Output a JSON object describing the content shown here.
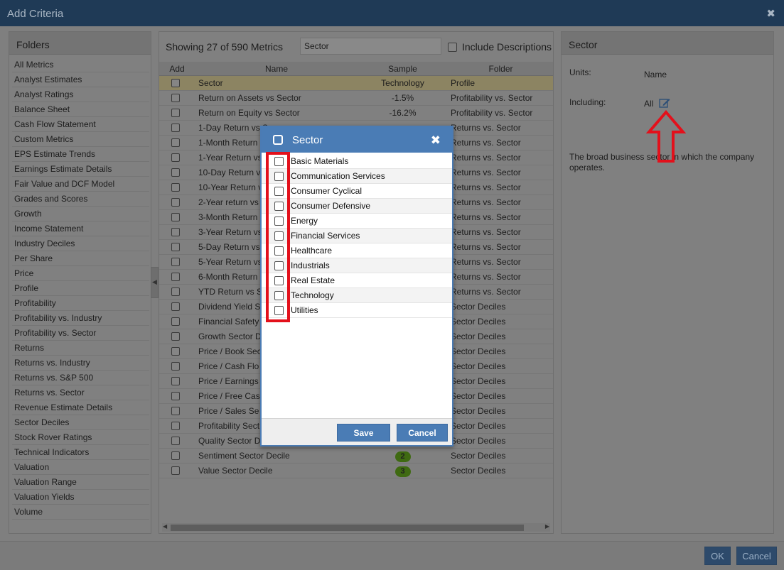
{
  "window": {
    "title": "Add Criteria",
    "close_glyph": "✖"
  },
  "folders": {
    "header": "Folders",
    "items": [
      "All Metrics",
      "Analyst Estimates",
      "Analyst Ratings",
      "Balance Sheet",
      "Cash Flow Statement",
      "Custom Metrics",
      "EPS Estimate Trends",
      "Earnings Estimate Details",
      "Fair Value and DCF Model",
      "Grades and Scores",
      "Growth",
      "Income Statement",
      "Industry Deciles",
      "Per Share",
      "Price",
      "Profile",
      "Profitability",
      "Profitability vs. Industry",
      "Profitability vs. Sector",
      "Returns",
      "Returns vs. Industry",
      "Returns vs. S&P 500",
      "Returns vs. Sector",
      "Revenue Estimate Details",
      "Sector Deciles",
      "Stock Rover Ratings",
      "Technical Indicators",
      "Valuation",
      "Valuation Range",
      "Valuation Yields",
      "Volume"
    ]
  },
  "metrics": {
    "showing": "Showing 27 of 590 Metrics",
    "search_value": "Sector",
    "include_descriptions": "Include Descriptions",
    "columns": {
      "add": "Add",
      "name": "Name",
      "sample": "Sample",
      "folder": "Folder"
    },
    "rows": [
      {
        "name": "Sector",
        "sample": "Technology",
        "folder": "Profile",
        "selected": true
      },
      {
        "name": "Return on Assets vs Sector",
        "sample": "-1.5%",
        "folder": "Profitability vs. Sector"
      },
      {
        "name": "Return on Equity vs Sector",
        "sample": "-16.2%",
        "folder": "Profitability vs. Sector"
      },
      {
        "name": "1-Day Return vs Se",
        "sample": "",
        "folder": "Returns vs. Sector"
      },
      {
        "name": "1-Month Return",
        "sample": "",
        "folder": "Returns vs. Sector"
      },
      {
        "name": "1-Year Return vs",
        "sample": "",
        "folder": "Returns vs. Sector"
      },
      {
        "name": "10-Day Return v",
        "sample": "",
        "folder": "Returns vs. Sector"
      },
      {
        "name": "10-Year Return v",
        "sample": "",
        "folder": "Returns vs. Sector"
      },
      {
        "name": "2-Year return vs",
        "sample": "",
        "folder": "Returns vs. Sector"
      },
      {
        "name": "3-Month Return",
        "sample": "",
        "folder": "Returns vs. Sector"
      },
      {
        "name": "3-Year Return vs",
        "sample": "",
        "folder": "Returns vs. Sector"
      },
      {
        "name": "5-Day Return vs",
        "sample": "",
        "folder": "Returns vs. Sector"
      },
      {
        "name": "5-Year Return vs",
        "sample": "",
        "folder": "Returns vs. Sector"
      },
      {
        "name": "6-Month Return",
        "sample": "",
        "folder": "Returns vs. Sector"
      },
      {
        "name": "YTD Return vs S",
        "sample": "",
        "folder": "Returns vs. Sector"
      },
      {
        "name": "Dividend Yield S",
        "sample": "",
        "folder": "Sector Deciles"
      },
      {
        "name": "Financial Safety",
        "sample": "",
        "folder": "Sector Deciles"
      },
      {
        "name": "Growth Sector D",
        "sample": "",
        "folder": "Sector Deciles"
      },
      {
        "name": "Price / Book Sec",
        "sample": "",
        "folder": "Sector Deciles"
      },
      {
        "name": "Price / Cash Flo",
        "sample": "",
        "folder": "Sector Deciles"
      },
      {
        "name": "Price / Earnings",
        "sample": "",
        "folder": "Sector Deciles"
      },
      {
        "name": "Price / Free Cas",
        "sample": "",
        "folder": "Sector Deciles"
      },
      {
        "name": "Price / Sales Se",
        "sample": "",
        "folder": "Sector Deciles"
      },
      {
        "name": "Profitability Sect",
        "sample": "",
        "folder": "Sector Deciles"
      },
      {
        "name": "Quality Sector D",
        "sample": "",
        "folder": "Sector Deciles"
      },
      {
        "name": "Sentiment Sector Decile",
        "sample": "2",
        "folder": "Sector Deciles",
        "pill": true
      },
      {
        "name": "Value Sector Decile",
        "sample": "3",
        "folder": "Sector Deciles",
        "pill": true
      }
    ]
  },
  "detail": {
    "header": "Sector",
    "units_label": "Units:",
    "units_value": "Name",
    "including_label": "Including:",
    "including_value": "All",
    "description": "The broad business sector in which the company operates."
  },
  "footer": {
    "ok": "OK",
    "cancel": "Cancel"
  },
  "modal": {
    "title": "Sector",
    "close_glyph": "✖",
    "options": [
      "Basic Materials",
      "Communication Services",
      "Consumer Cyclical",
      "Consumer Defensive",
      "Energy",
      "Financial Services",
      "Healthcare",
      "Industrials",
      "Real Estate",
      "Technology",
      "Utilities"
    ],
    "save": "Save",
    "cancel": "Cancel"
  },
  "colors": {
    "modal_accent": "#4a7cb5",
    "highlight": "#e3101b",
    "titlebar": "#1f3a56"
  }
}
